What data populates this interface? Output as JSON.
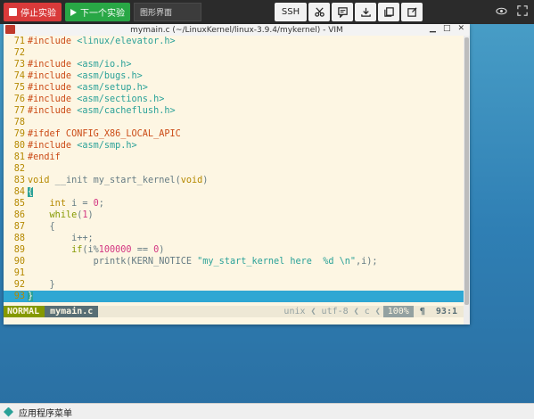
{
  "toolbar": {
    "stop_label": "停止实验",
    "next_label": "下一个实验",
    "view_select": "图形界面",
    "ssh_label": "SSH"
  },
  "vim": {
    "title": "mymain.c (~/LinuxKernel/linux-3.9.4/mykernel) - VIM",
    "lines": [
      {
        "n": "71",
        "segs": [
          {
            "t": "#include ",
            "c": "pp"
          },
          {
            "t": "<linux/elevator.h>",
            "c": "inc"
          }
        ]
      },
      {
        "n": "72",
        "segs": []
      },
      {
        "n": "73",
        "segs": [
          {
            "t": "#include ",
            "c": "pp"
          },
          {
            "t": "<asm/io.h>",
            "c": "inc"
          }
        ]
      },
      {
        "n": "74",
        "segs": [
          {
            "t": "#include ",
            "c": "pp"
          },
          {
            "t": "<asm/bugs.h>",
            "c": "inc"
          }
        ]
      },
      {
        "n": "75",
        "segs": [
          {
            "t": "#include ",
            "c": "pp"
          },
          {
            "t": "<asm/setup.h>",
            "c": "inc"
          }
        ]
      },
      {
        "n": "76",
        "segs": [
          {
            "t": "#include ",
            "c": "pp"
          },
          {
            "t": "<asm/sections.h>",
            "c": "inc"
          }
        ]
      },
      {
        "n": "77",
        "segs": [
          {
            "t": "#include ",
            "c": "pp"
          },
          {
            "t": "<asm/cacheflush.h>",
            "c": "inc"
          }
        ]
      },
      {
        "n": "78",
        "segs": []
      },
      {
        "n": "79",
        "segs": [
          {
            "t": "#ifdef CONFIG_X86_LOCAL_APIC",
            "c": "pp"
          }
        ]
      },
      {
        "n": "80",
        "segs": [
          {
            "t": "#include ",
            "c": "pp"
          },
          {
            "t": "<asm/smp.h>",
            "c": "inc"
          }
        ]
      },
      {
        "n": "81",
        "segs": [
          {
            "t": "#endif",
            "c": "pp"
          }
        ]
      },
      {
        "n": "82",
        "segs": []
      },
      {
        "n": "83",
        "segs": [
          {
            "t": "void",
            "c": "ty"
          },
          {
            "t": " __init my_start_kernel(",
            "c": "code"
          },
          {
            "t": "void",
            "c": "ty"
          },
          {
            "t": ")",
            "c": "code"
          }
        ]
      },
      {
        "n": "84",
        "segs": [
          {
            "t": "{",
            "c": "cursorbrace"
          }
        ]
      },
      {
        "n": "85",
        "segs": [
          {
            "t": "    ",
            "c": "code"
          },
          {
            "t": "int",
            "c": "ty"
          },
          {
            "t": " i = ",
            "c": "code"
          },
          {
            "t": "0",
            "c": "num"
          },
          {
            "t": ";",
            "c": "code"
          }
        ]
      },
      {
        "n": "86",
        "segs": [
          {
            "t": "    ",
            "c": "code"
          },
          {
            "t": "while",
            "c": "kw"
          },
          {
            "t": "(",
            "c": "code"
          },
          {
            "t": "1",
            "c": "num"
          },
          {
            "t": ")",
            "c": "code"
          }
        ]
      },
      {
        "n": "87",
        "segs": [
          {
            "t": "    {",
            "c": "code"
          }
        ]
      },
      {
        "n": "88",
        "segs": [
          {
            "t": "        i++;",
            "c": "code"
          }
        ]
      },
      {
        "n": "89",
        "segs": [
          {
            "t": "        ",
            "c": "code"
          },
          {
            "t": "if",
            "c": "kw"
          },
          {
            "t": "(i%",
            "c": "code"
          },
          {
            "t": "100000",
            "c": "num"
          },
          {
            "t": " == ",
            "c": "code"
          },
          {
            "t": "0",
            "c": "num"
          },
          {
            "t": ")",
            "c": "code"
          }
        ]
      },
      {
        "n": "90",
        "segs": [
          {
            "t": "            printk(KERN_NOTICE ",
            "c": "code"
          },
          {
            "t": "\"my_start_kernel here  %d \\n\"",
            "c": "str"
          },
          {
            "t": ",i);",
            "c": "code"
          }
        ]
      },
      {
        "n": "91",
        "segs": []
      },
      {
        "n": "92",
        "segs": [
          {
            "t": "    }",
            "c": "code"
          }
        ]
      },
      {
        "n": "93",
        "segs": [
          {
            "t": "}",
            "c": "cursorbrace"
          }
        ]
      }
    ],
    "status": {
      "mode": "NORMAL",
      "filename": "mymain.c",
      "fileformat": "unix",
      "encoding": "utf-8",
      "filetype": "c",
      "percent": "100%",
      "position": "93:1"
    }
  },
  "taskbar": {
    "menu_label": "应用程序菜单"
  }
}
